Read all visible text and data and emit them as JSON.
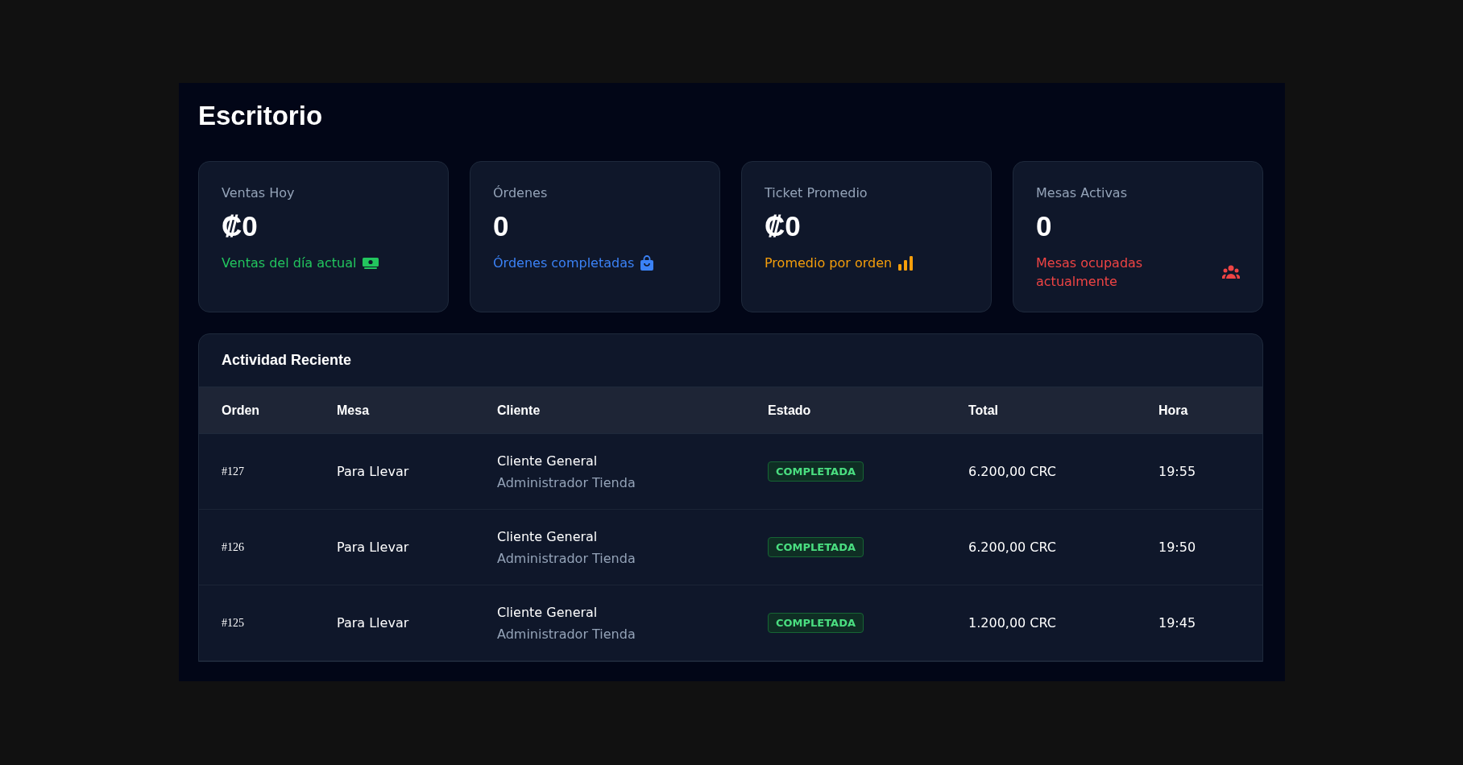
{
  "page": {
    "title": "Escritorio"
  },
  "stats": [
    {
      "label": "Ventas Hoy",
      "value": "₡0",
      "note": "Ventas del día actual",
      "kind": "money",
      "color": "#22c55e"
    },
    {
      "label": "Órdenes",
      "value": "0",
      "note": "Órdenes completadas",
      "kind": "bag",
      "color": "#3b82f6"
    },
    {
      "label": "Ticket Promedio",
      "value": "₡0",
      "note": "Promedio por orden",
      "kind": "bars",
      "color": "#f59e0b"
    },
    {
      "label": "Mesas Activas",
      "value": "0",
      "note": "Mesas ocupadas actualmente",
      "kind": "people",
      "color": "#ef4444"
    }
  ],
  "activity": {
    "title": "Actividad Reciente",
    "columns": [
      "Orden",
      "Mesa",
      "Cliente",
      "Estado",
      "Total",
      "Hora"
    ],
    "rows": [
      {
        "order": "#127",
        "table": "Para Llevar",
        "client": "Cliente General",
        "staff": "Administrador Tienda",
        "status": "COMPLETADA",
        "total": "6.200,00 CRC",
        "time": "19:55"
      },
      {
        "order": "#126",
        "table": "Para Llevar",
        "client": "Cliente General",
        "staff": "Administrador Tienda",
        "status": "COMPLETADA",
        "total": "6.200,00 CRC",
        "time": "19:50"
      },
      {
        "order": "#125",
        "table": "Para Llevar",
        "client": "Cliente General",
        "staff": "Administrador Tienda",
        "status": "COMPLETADA",
        "total": "1.200,00 CRC",
        "time": "19:45"
      }
    ]
  }
}
